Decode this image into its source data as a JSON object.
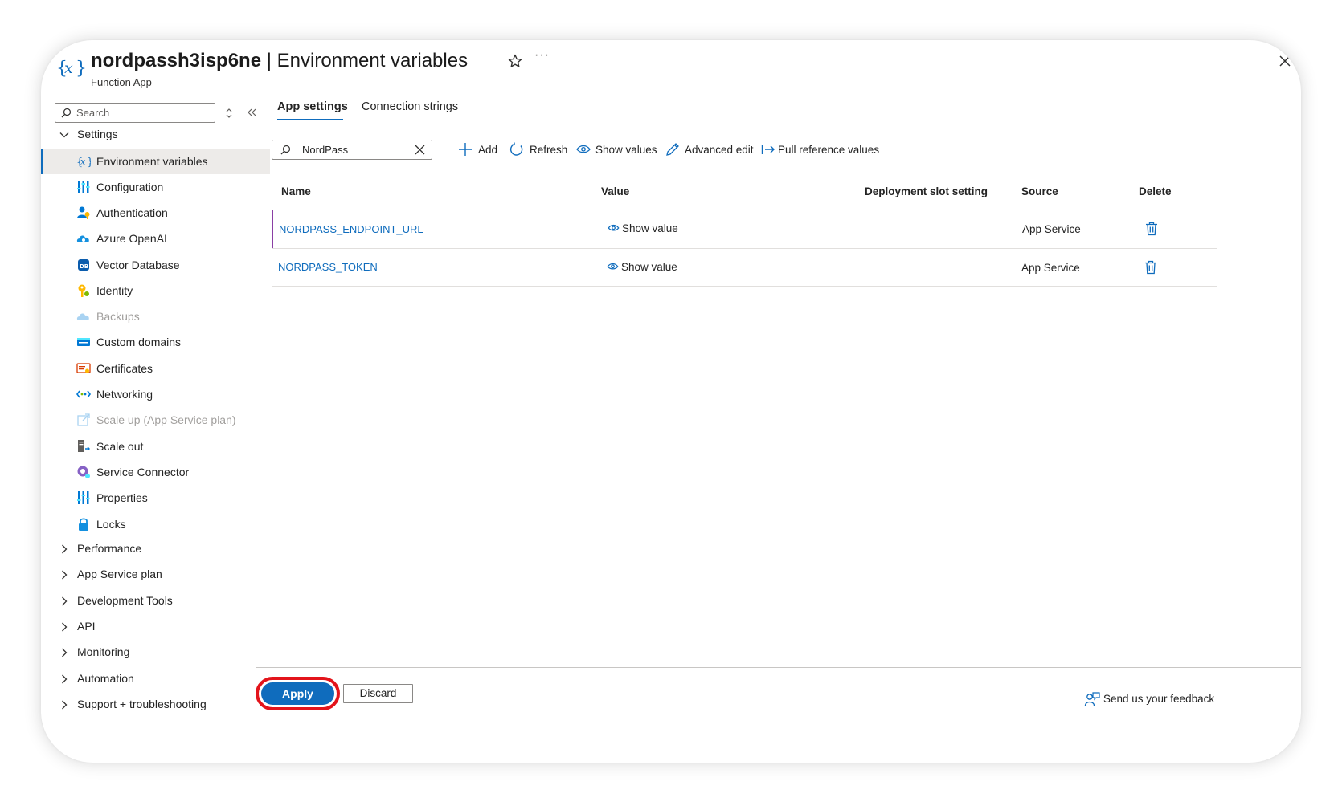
{
  "header": {
    "resource_name": "nordpassh3isp6ne",
    "separator": " | ",
    "page_title": "Environment variables",
    "resource_type": "Function App",
    "icon": "environment-variables-icon"
  },
  "sidebar": {
    "search_placeholder": "Search",
    "groups": [
      {
        "label": "Settings",
        "expanded": true
      },
      {
        "label": "Performance"
      },
      {
        "label": "App Service plan"
      },
      {
        "label": "Development Tools"
      },
      {
        "label": "API"
      },
      {
        "label": "Monitoring"
      },
      {
        "label": "Automation"
      },
      {
        "label": "Support + troubleshooting"
      }
    ],
    "items": [
      {
        "label": "Environment variables",
        "icon": "environment-variables-icon",
        "active": true
      },
      {
        "label": "Configuration",
        "icon": "configuration-icon"
      },
      {
        "label": "Authentication",
        "icon": "authentication-icon"
      },
      {
        "label": "Azure OpenAI",
        "icon": "azure-openai-icon"
      },
      {
        "label": "Vector Database",
        "icon": "vector-database-icon"
      },
      {
        "label": "Identity",
        "icon": "identity-icon"
      },
      {
        "label": "Backups",
        "icon": "backups-icon",
        "disabled": true
      },
      {
        "label": "Custom domains",
        "icon": "custom-domains-icon"
      },
      {
        "label": "Certificates",
        "icon": "certificates-icon"
      },
      {
        "label": "Networking",
        "icon": "networking-icon"
      },
      {
        "label": "Scale up (App Service plan)",
        "icon": "scale-up-icon",
        "disabled": true
      },
      {
        "label": "Scale out",
        "icon": "scale-out-icon"
      },
      {
        "label": "Service Connector",
        "icon": "service-connector-icon"
      },
      {
        "label": "Properties",
        "icon": "properties-icon"
      },
      {
        "label": "Locks",
        "icon": "locks-icon"
      }
    ]
  },
  "tabs": [
    {
      "label": "App settings",
      "active": true
    },
    {
      "label": "Connection strings"
    }
  ],
  "toolbar": {
    "filter_value": "NordPass",
    "add": "Add",
    "refresh": "Refresh",
    "show_values": "Show values",
    "advanced_edit": "Advanced edit",
    "pull_reference_values": "Pull reference values"
  },
  "table": {
    "columns": [
      "Name",
      "Value",
      "Deployment slot setting",
      "Source",
      "Delete"
    ],
    "rows": [
      {
        "name": "NORDPASS_ENDPOINT_URL",
        "value": "Show value",
        "deployment_slot_setting": "",
        "source": "App Service"
      },
      {
        "name": "NORDPASS_TOKEN",
        "value": "Show value",
        "deployment_slot_setting": "",
        "source": "App Service"
      }
    ]
  },
  "footer": {
    "apply": "Apply",
    "discard": "Discard",
    "feedback": "Send us your feedback"
  },
  "colors": {
    "accent": "#0f6cbd",
    "highlight_ring": "#e3141b",
    "row_accent": "#8a3fa4"
  }
}
